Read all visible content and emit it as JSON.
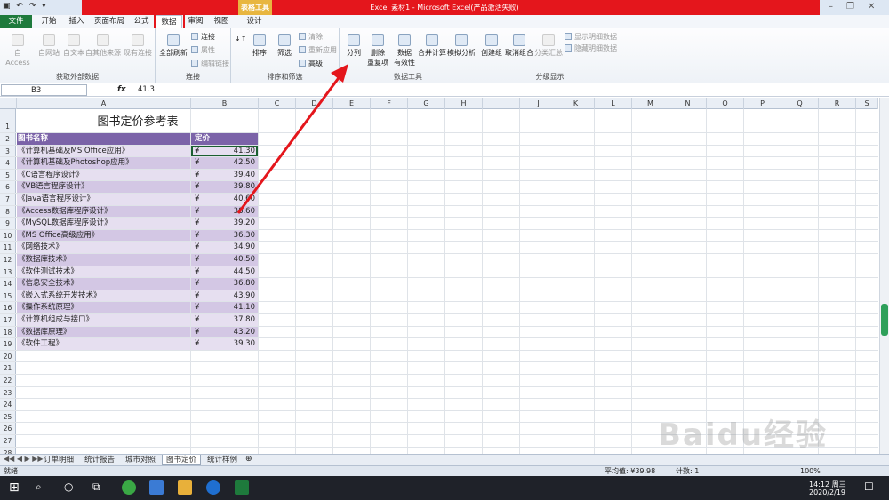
{
  "window": {
    "title": "Excel 素材1 - Microsoft Excel(产品激活失败)",
    "context_tab": "表格工具"
  },
  "ribbon_tabs": [
    "文件",
    "开始",
    "插入",
    "页面布局",
    "公式",
    "数据",
    "审阅",
    "视图",
    "设计"
  ],
  "active_tab": "数据",
  "ribbon": {
    "get_external": {
      "label": "获取外部数据",
      "from_access": "自 Access",
      "from_web": "自网站",
      "from_text": "自文本",
      "from_other": "自其他来源",
      "existing": "现有连接"
    },
    "connections": {
      "label": "连接",
      "refresh_all": "全部刷新",
      "connections": "连接",
      "properties": "属性",
      "edit_links": "编辑链接"
    },
    "sort_filter": {
      "label": "排序和筛选",
      "sort": "排序",
      "filter": "筛选",
      "clear": "清除",
      "reapply": "重新应用",
      "advanced": "高级"
    },
    "data_tools": {
      "label": "数据工具",
      "text_to_columns": "分列",
      "remove_duplicates_1": "删除",
      "remove_duplicates_2": "重复项",
      "validation_1": "数据",
      "validation_2": "有效性",
      "consolidate": "合并计算",
      "whatif": "模拟分析"
    },
    "outline": {
      "label": "分级显示",
      "group": "创建组",
      "ungroup": "取消组合",
      "subtotal": "分类汇总",
      "show_detail": "显示明细数据",
      "hide_detail": "隐藏明细数据"
    }
  },
  "formula_bar": {
    "name_box": "B3",
    "fx": "fx",
    "value": "41.3"
  },
  "columns": [
    "A",
    "B",
    "C",
    "D",
    "E",
    "F",
    "G",
    "H",
    "I",
    "J",
    "K",
    "L",
    "M",
    "N",
    "O",
    "P",
    "Q",
    "R",
    "S"
  ],
  "sheet": {
    "title": "图书定价参考表",
    "header": [
      "图书名称",
      "定价"
    ],
    "currency": "¥",
    "rows": [
      {
        "name": "《计算机基础及MS Office应用》",
        "price": "41.30"
      },
      {
        "name": "《计算机基础及Photoshop应用》",
        "price": "42.50"
      },
      {
        "name": "《C语言程序设计》",
        "price": "39.40"
      },
      {
        "name": "《VB语言程序设计》",
        "price": "39.80"
      },
      {
        "name": "《Java语言程序设计》",
        "price": "40.60"
      },
      {
        "name": "《Access数据库程序设计》",
        "price": "38.60"
      },
      {
        "name": "《MySQL数据库程序设计》",
        "price": "39.20"
      },
      {
        "name": "《MS Office高级应用》",
        "price": "36.30"
      },
      {
        "name": "《网络技术》",
        "price": "34.90"
      },
      {
        "name": "《数据库技术》",
        "price": "40.50"
      },
      {
        "name": "《软件测试技术》",
        "price": "44.50"
      },
      {
        "name": "《信息安全技术》",
        "price": "36.80"
      },
      {
        "name": "《嵌入式系统开发技术》",
        "price": "43.90"
      },
      {
        "name": "《操作系统原理》",
        "price": "41.10"
      },
      {
        "name": "《计算机组成与接口》",
        "price": "37.80"
      },
      {
        "name": "《数据库原理》",
        "price": "43.20"
      },
      {
        "name": "《软件工程》",
        "price": "39.30"
      }
    ],
    "row_numbers": [
      "1",
      "2",
      "3",
      "4",
      "5",
      "6",
      "7",
      "8",
      "9",
      "10",
      "11",
      "12",
      "13",
      "14",
      "15",
      "16",
      "17",
      "18",
      "19",
      "20",
      "21",
      "22",
      "23",
      "24",
      "25",
      "26",
      "27",
      "28"
    ]
  },
  "sheet_tabs": [
    "订单明细",
    "统计报告",
    "城市对照",
    "图书定价",
    "统计样例"
  ],
  "active_sheet": "图书定价",
  "status": {
    "ready": "就绪",
    "average": "平均值: ¥39.98",
    "count": "计数: 1",
    "zoom": "100%"
  },
  "taskbar": {
    "time": "14:12 周三",
    "date": "2020/2/19"
  },
  "watermark": "Baidu经验",
  "colors": {
    "excel_green": "#1e7a3c",
    "title_red": "#e4161c",
    "header_purple": "#7b63a8",
    "band_light": "#e6dff0",
    "band_dark": "#d3c7e4"
  }
}
